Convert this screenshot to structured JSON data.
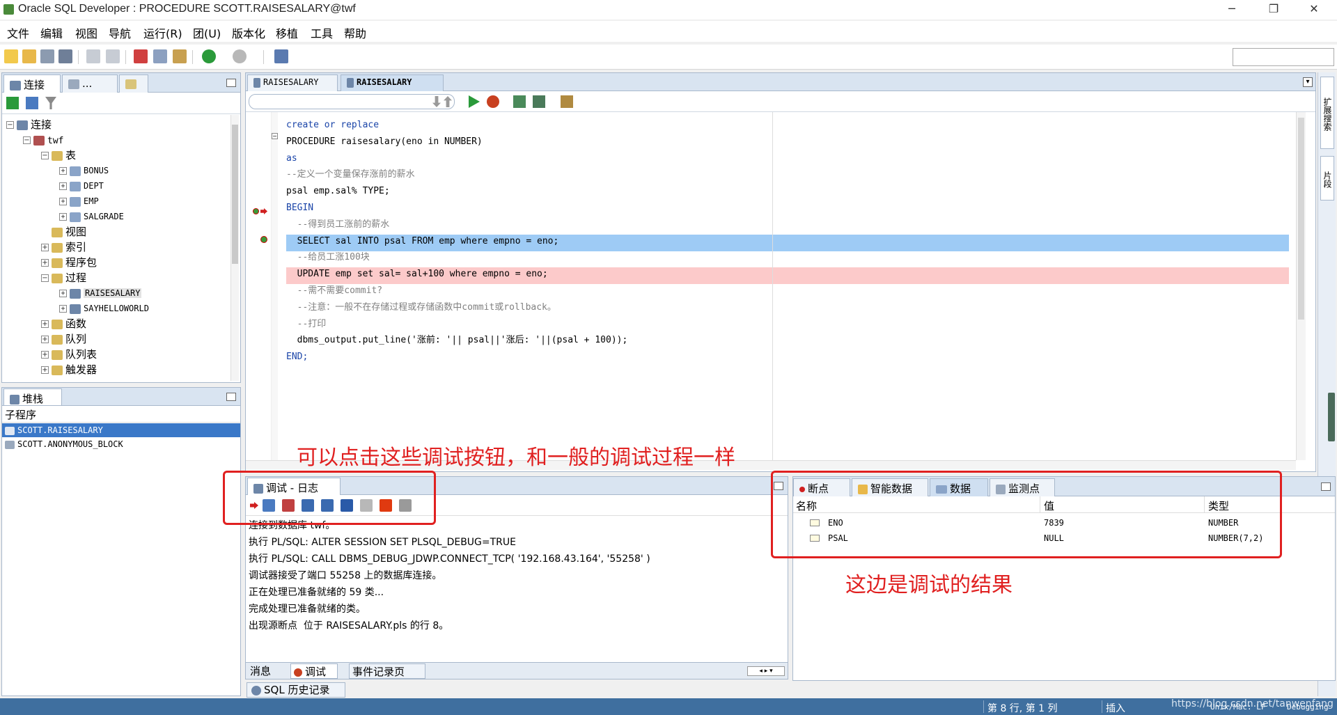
{
  "window": {
    "title": "Oracle SQL Developer : PROCEDURE SCOTT.RAISESALARY@twf"
  },
  "menu": [
    "文件",
    "编辑",
    "视图",
    "导航",
    "运行(R)",
    "团(U)",
    "版本化",
    "移植",
    "工具",
    "帮助"
  ],
  "left_panel": {
    "tabs": [
      "连接",
      "...",
      ""
    ],
    "tree": {
      "root": "连接",
      "connection": "twf",
      "tables_label": "表",
      "tables": [
        "BONUS",
        "DEPT",
        "EMP",
        "SALGRADE"
      ],
      "views": "视图",
      "indexes": "索引",
      "packages": "程序包",
      "procedures_label": "过程",
      "procedures": [
        "RAISESALARY",
        "SAYHELLOWORLD"
      ],
      "functions": "函数",
      "queues": "队列",
      "queue_tables": "队列表",
      "triggers": "触发器"
    }
  },
  "stack_panel": {
    "tab": "堆栈",
    "header": "子程序",
    "rows": [
      "SCOTT.RAISESALARY",
      "SCOTT.ANONYMOUS_BLOCK"
    ]
  },
  "editor": {
    "tabs": [
      "RAISESALARY",
      "RAISESALARY"
    ],
    "lines": [
      "create or replace",
      "PROCEDURE raisesalary(eno in NUMBER)",
      "as",
      "--定义一个变量保存涨前的薪水",
      "psal emp.sal% TYPE;",
      "BEGIN",
      "  --得到员工涨前的薪水",
      "  SELECT sal INTO psal FROM emp where empno = eno;",
      "  --给员工涨100块",
      "  UPDATE emp set sal= sal+100 where empno = eno;",
      "  --需不需要commit?",
      "  --注意：一般不在存储过程或存储函数中commit或rollback。",
      "  --打印",
      "  dbms_output.put_line('涨前: '|| psal||'涨后: '||(psal + 100));",
      "END;"
    ]
  },
  "debug_panel": {
    "tab": "调试 - 日志",
    "log": [
      "连接到数据库 twf。",
      "执行 PL/SQL: ALTER SESSION SET PLSQL_DEBUG=TRUE",
      "执行 PL/SQL: CALL DBMS_DEBUG_JDWP.CONNECT_TCP( '192.168.43.164', '55258' )",
      "调试器接受了端口 55258 上的数据库连接。",
      "正在处理已准备就绪的 59 类...",
      "完成处理已准备就绪的类。",
      "出现源断点  位于 RAISESALARY.pls 的行 8。"
    ],
    "bottom_tabs": [
      "消息",
      "调试",
      "事件记录页"
    ]
  },
  "data_panel": {
    "tabs": [
      "断点",
      "智能数据",
      "数据",
      "监测点"
    ],
    "columns": [
      "名称",
      "值",
      "类型"
    ],
    "rows": [
      {
        "name": "ENO",
        "value": "7839",
        "type": "NUMBER"
      },
      {
        "name": "PSAL",
        "value": "NULL",
        "type": "NUMBER(7,2)"
      }
    ]
  },
  "sql_history_tab": "SQL 历史记录",
  "right_rail": [
    "扩展搜索",
    "片段"
  ],
  "annotations": {
    "top": "可以点击这些调试按钮，和一般的调试过程一样",
    "right": "这边是调试的结果"
  },
  "status": {
    "position": "第 8 行, 第 1 列",
    "mode": "插入",
    "eol": "Unix/Mac: LF",
    "state": "Debugging",
    "watermark": "https://blog.csdn.net/tanwenfang"
  },
  "colors": {
    "highlight_exec": "#9ecbf5",
    "highlight_break": "#fccaca",
    "annotation": "#e02020",
    "status_bar": "#3f6f9f"
  }
}
